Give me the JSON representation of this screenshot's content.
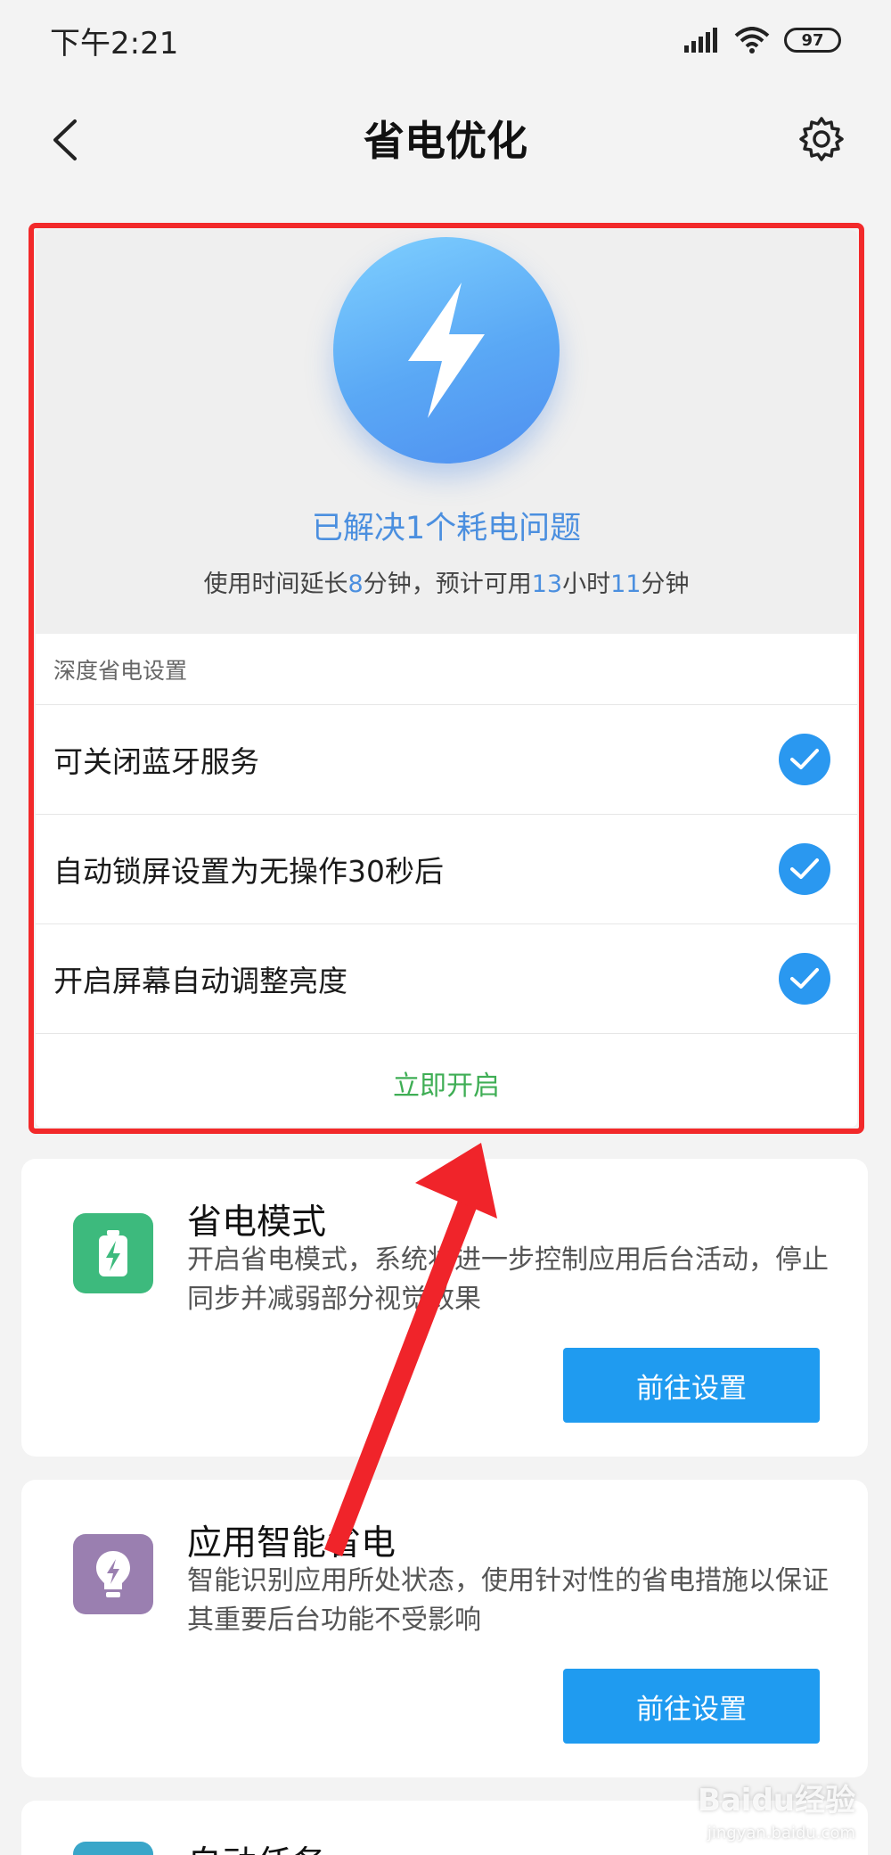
{
  "status_bar": {
    "time": "下午2:21",
    "battery": "97"
  },
  "header": {
    "title": "省电优化"
  },
  "hero": {
    "title": "已解决1个耗电问题",
    "sub_prefix": "使用时间延长",
    "sub_min": "8",
    "sub_mid": "分钟，预计可用",
    "sub_hours": "13",
    "sub_hours_unit": "小时",
    "sub_mins": "11",
    "sub_suffix": "分钟"
  },
  "deep_settings": {
    "header": "深度省电设置",
    "items": [
      {
        "label": "可关闭蓝牙服务",
        "checked": true
      },
      {
        "label": "自动锁屏设置为无操作30秒后",
        "checked": true
      },
      {
        "label": "开启屏幕自动调整亮度",
        "checked": true
      }
    ],
    "enable_label": "立即开启"
  },
  "features": [
    {
      "title": "省电模式",
      "desc": "开启省电模式，系统将进一步控制应用后台活动，停止同步并减弱部分视觉效果",
      "button": "前往设置",
      "icon_color": "#3dba7d"
    },
    {
      "title": "应用智能省电",
      "desc": "智能识别应用所处状态，使用针对性的省电措施以保证其重要后台功能不受影响",
      "button": "前往设置",
      "icon_color": "#9a7fb0"
    },
    {
      "title": "自动任务",
      "desc": "",
      "button": "",
      "icon_color": "#3aa6c9"
    }
  ],
  "watermark": {
    "main": "Baidu经验",
    "sub": "jingyan.baidu.com"
  },
  "colors": {
    "accent": "#2a98f0",
    "annotation": "#f2292a",
    "enable_text": "#3fae55"
  }
}
